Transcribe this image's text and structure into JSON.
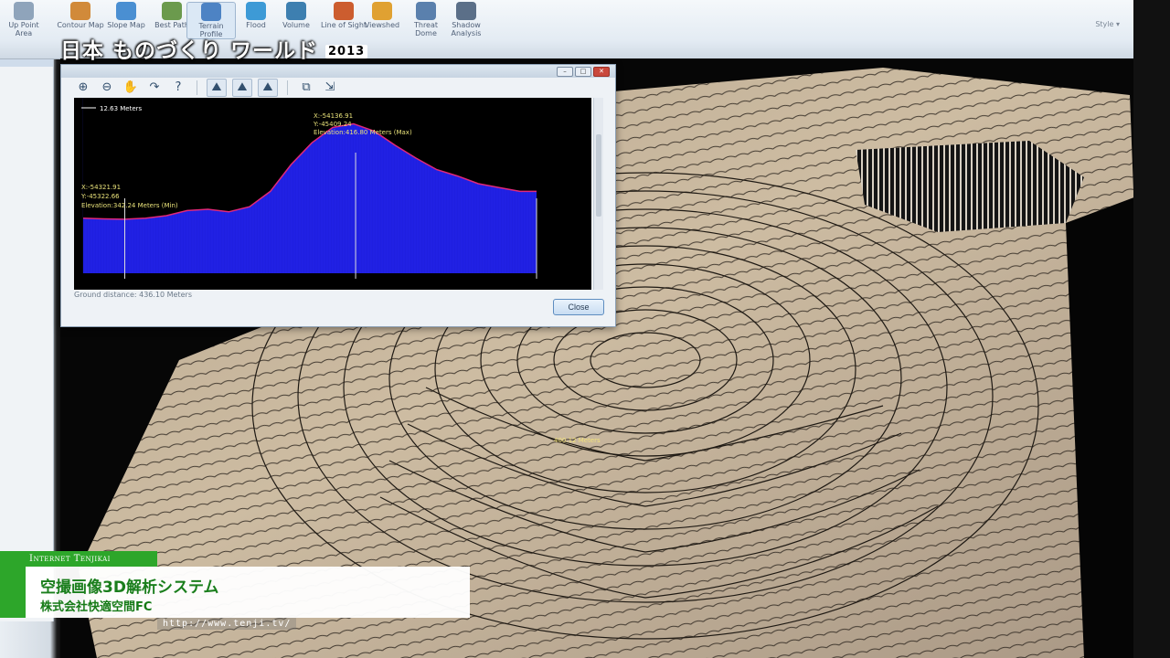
{
  "broadcast": {
    "show_title": "日本 ものづくり ワールド",
    "show_year": "2013",
    "channel_label": "Internet Tenjikai",
    "caption_title": "空撮画像3D解析システム",
    "caption_company": "株式会社快適空間FC",
    "url": "http://www.tenji.tv/"
  },
  "ribbon": {
    "items": [
      {
        "label": "Up Point Area",
        "icon": "area-icon"
      },
      {
        "label": "Contour Map",
        "icon": "contour-map-icon"
      },
      {
        "label": "Slope Map",
        "icon": "slope-map-icon"
      },
      {
        "label": "Best Path",
        "icon": "best-path-icon"
      },
      {
        "label": "Terrain Profile",
        "icon": "terrain-profile-icon",
        "active": true
      },
      {
        "label": "Flood",
        "icon": "flood-icon"
      },
      {
        "label": "Volume",
        "icon": "volume-icon"
      },
      {
        "label": "Line of Sight",
        "icon": "line-of-sight-icon"
      },
      {
        "label": "Viewshed",
        "icon": "viewshed-icon"
      },
      {
        "label": "Threat Dome",
        "icon": "threat-dome-icon"
      },
      {
        "label": "Shadow Analysis",
        "icon": "shadow-analysis-icon"
      }
    ],
    "right_label": "Style ▾"
  },
  "profile_window": {
    "scale_label": "12.63 Meters",
    "ground_distance": "Ground distance: 436.10 Meters",
    "close_label": "Close",
    "toolbar": [
      "zoom-in-icon",
      "zoom-out-icon",
      "pan-icon",
      "redo-icon",
      "help-icon",
      "profile-view-1-icon",
      "profile-view-2-icon",
      "profile-view-3-icon",
      "copy-icon",
      "export-icon"
    ],
    "max_point": {
      "x": "X:-54136.91",
      "y": "Y:-45409.24",
      "elev": "Elevation:416.80 Meters (Max)"
    },
    "min_point": {
      "x": "X:-54321.91",
      "y": "Y:-45322.66",
      "elev": "Elevation:342.24 Meters (Min)"
    }
  },
  "terrain": {
    "contour_label": "400.12 Meters"
  },
  "chart_data": {
    "type": "area",
    "xlabel": "",
    "ylabel": "",
    "x": [
      0,
      20,
      40,
      60,
      80,
      100,
      120,
      140,
      160,
      180,
      200,
      220,
      240,
      260,
      280,
      300,
      320,
      340,
      360,
      380,
      400,
      420,
      436
    ],
    "series": [
      {
        "values": [
          343,
          342.5,
          342.24,
          343,
          345,
          349,
          350,
          348,
          352,
          364,
          385,
          402,
          414,
          416.8,
          411,
          400,
          390,
          381,
          376,
          370,
          367,
          364,
          364
        ]
      }
    ],
    "ylim": [
      300,
      430
    ],
    "fill_color": "#1f1fe0",
    "line_color": "#e0287a",
    "marker_lines_x": [
      40,
      262,
      436
    ]
  }
}
